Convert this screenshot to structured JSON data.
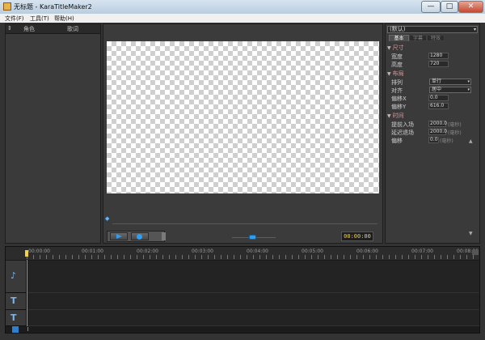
{
  "window": {
    "title": "无标题 - KaraTitleMaker2",
    "icons": {
      "app": "app-icon",
      "minimize": "minimize-icon",
      "maximize": "maximize-icon",
      "close": "close-icon"
    },
    "min_glyph": "—",
    "max_glyph": "□",
    "close_glyph": "✕"
  },
  "menu": {
    "items": [
      {
        "label": "文件(F)"
      },
      {
        "label": "工具(T)"
      },
      {
        "label": "帮助(H)"
      }
    ]
  },
  "left_panel": {
    "headers": [
      {
        "label": "⇕"
      },
      {
        "label": "角色"
      },
      {
        "label": "歌词"
      }
    ]
  },
  "preview": {
    "timecode": "00:00:00",
    "icons": {
      "play": "play-icon",
      "record": "record-icon",
      "seek": "seek-handle-icon"
    },
    "seek_glyph": "◆"
  },
  "properties": {
    "preset": "(默认)",
    "tabs": [
      {
        "label": "基本",
        "active": true
      },
      {
        "label": "字幕",
        "active": false
      },
      {
        "label": "特效",
        "active": false
      }
    ],
    "sections": {
      "size": "尺寸",
      "layout": "布局",
      "timing": "时间"
    },
    "fields": {
      "width_label": "宽度",
      "width_value": "1280",
      "height_label": "高度",
      "height_value": "720",
      "arrange_label": "排列",
      "arrange_value": "单行",
      "align_label": "对齐",
      "align_value": "居中",
      "offset_x_label": "偏移X",
      "offset_x_value": "0.0",
      "offset_y_label": "偏移Y",
      "offset_y_value": "616.0",
      "advance_in_label": "提前入场",
      "advance_in_value": "2000.0",
      "advance_in_unit": "(毫秒)",
      "delay_out_label": "延迟退场",
      "delay_out_value": "2000.0",
      "delay_out_unit": "(毫秒)",
      "offset_label": "偏移",
      "offset_value": "0.0",
      "offset_unit": "(毫秒)"
    },
    "triangle_glyph": "▼",
    "dropdown_glyph": "▾"
  },
  "timeline": {
    "ticks": [
      "00:00:00",
      "00:01:00",
      "00:02:00",
      "00:03:00",
      "00:04:00",
      "00:05:00",
      "00:06:00",
      "00:07:00",
      "00:08:00"
    ],
    "tracks": [
      {
        "icon": "music-note-icon",
        "glyph": "♪"
      },
      {
        "icon": "text-track-icon",
        "glyph": "T"
      },
      {
        "icon": "text-track-icon",
        "glyph": "T"
      }
    ]
  },
  "colors": {
    "accent": "#2f9df0",
    "timecode": "#f0d24a",
    "section_header": "#d89a9a"
  }
}
